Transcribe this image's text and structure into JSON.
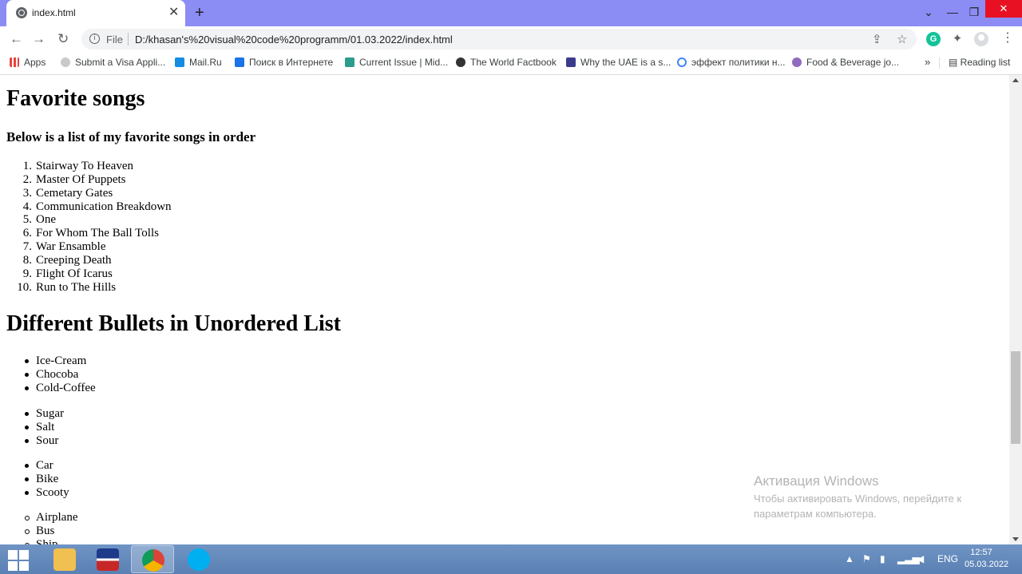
{
  "browser": {
    "tab_title": "index.html",
    "tab_close": "✕",
    "new_tab": "+",
    "url_scheme_label": "File",
    "url": "D:/khasan's%20visual%20code%20programm/01.03.2022/index.html",
    "bookmarks": [
      {
        "label": "Apps",
        "color": "#e8453c"
      },
      {
        "label": "Submit a Visa Appli...",
        "color": "#c9c9c9"
      },
      {
        "label": "Mail.Ru",
        "color": "#168de2"
      },
      {
        "label": "Поиск в Интернете",
        "color": "#1a73e8"
      },
      {
        "label": "Current Issue | Mid...",
        "color": "#2a9d8f"
      },
      {
        "label": "The World Factbook",
        "color": "#333333"
      },
      {
        "label": "Why the UAE is a s...",
        "color": "#3b3b8c"
      },
      {
        "label": "эффект политики н...",
        "color": "#4285f4"
      },
      {
        "label": "Food & Beverage jo...",
        "color": "#8e6bbf"
      }
    ],
    "bookmarks_more": "»",
    "reading_list": "Reading list"
  },
  "page": {
    "heading1": "Favorite songs",
    "subheading": "Below is a list of my favorite songs in order",
    "songs": [
      "Stairway To Heaven",
      "Master Of Puppets",
      "Cemetary Gates",
      "Communication Breakdown",
      "One",
      "For Whom The Ball Tolls",
      "War Ensamble",
      "Creeping Death",
      "Flight Of Icarus",
      "Run to The Hills"
    ],
    "heading2": "Different Bullets in Unordered List",
    "list1": [
      "Ice-Cream",
      "Chocoba",
      "Cold-Coffee"
    ],
    "list2": [
      "Sugar",
      "Salt",
      "Sour"
    ],
    "list3": [
      "Car",
      "Bike",
      "Scooty"
    ],
    "list4": [
      "Airplane",
      "Bus",
      "Ship"
    ]
  },
  "watermark": {
    "title": "Активация Windows",
    "text": "Чтобы активировать Windows, перейдите к параметрам компьютера."
  },
  "taskbar": {
    "lang": "ENG",
    "time": "12:57",
    "date": "05.03.2022"
  }
}
